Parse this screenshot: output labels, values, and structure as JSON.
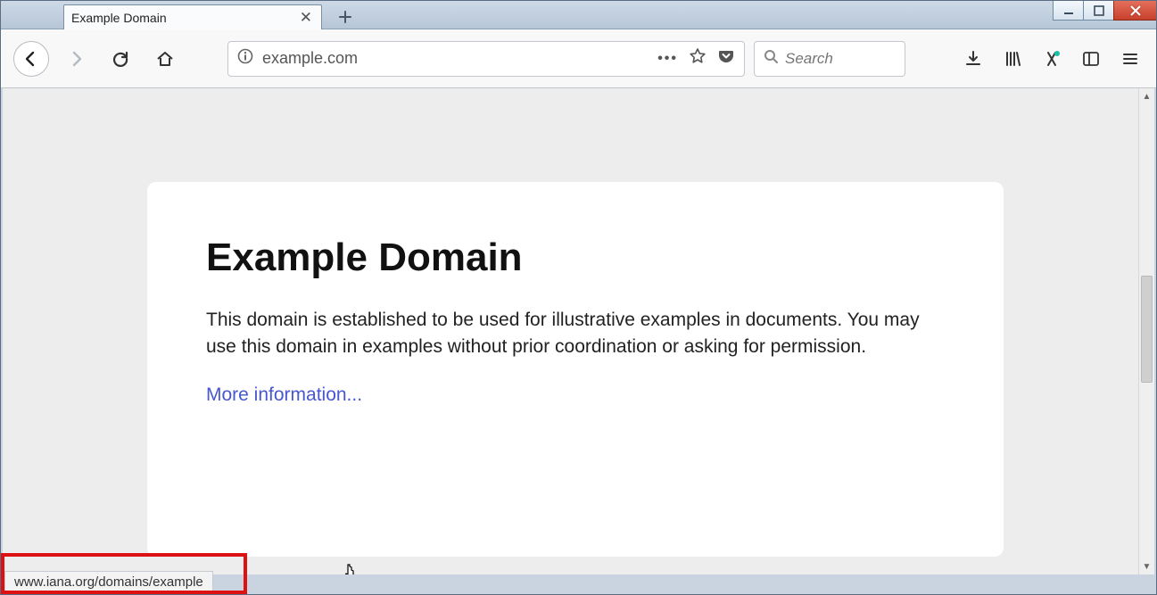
{
  "tab": {
    "title": "Example Domain"
  },
  "toolbar": {
    "url": "example.com",
    "search_placeholder": "Search"
  },
  "page": {
    "heading": "Example Domain",
    "paragraph": "This domain is established to be used for illustrative examples in documents. You may use this domain in examples without prior coordination or asking for permission.",
    "link_text": "More information..."
  },
  "status": {
    "hover_url": "www.iana.org/domains/example"
  }
}
